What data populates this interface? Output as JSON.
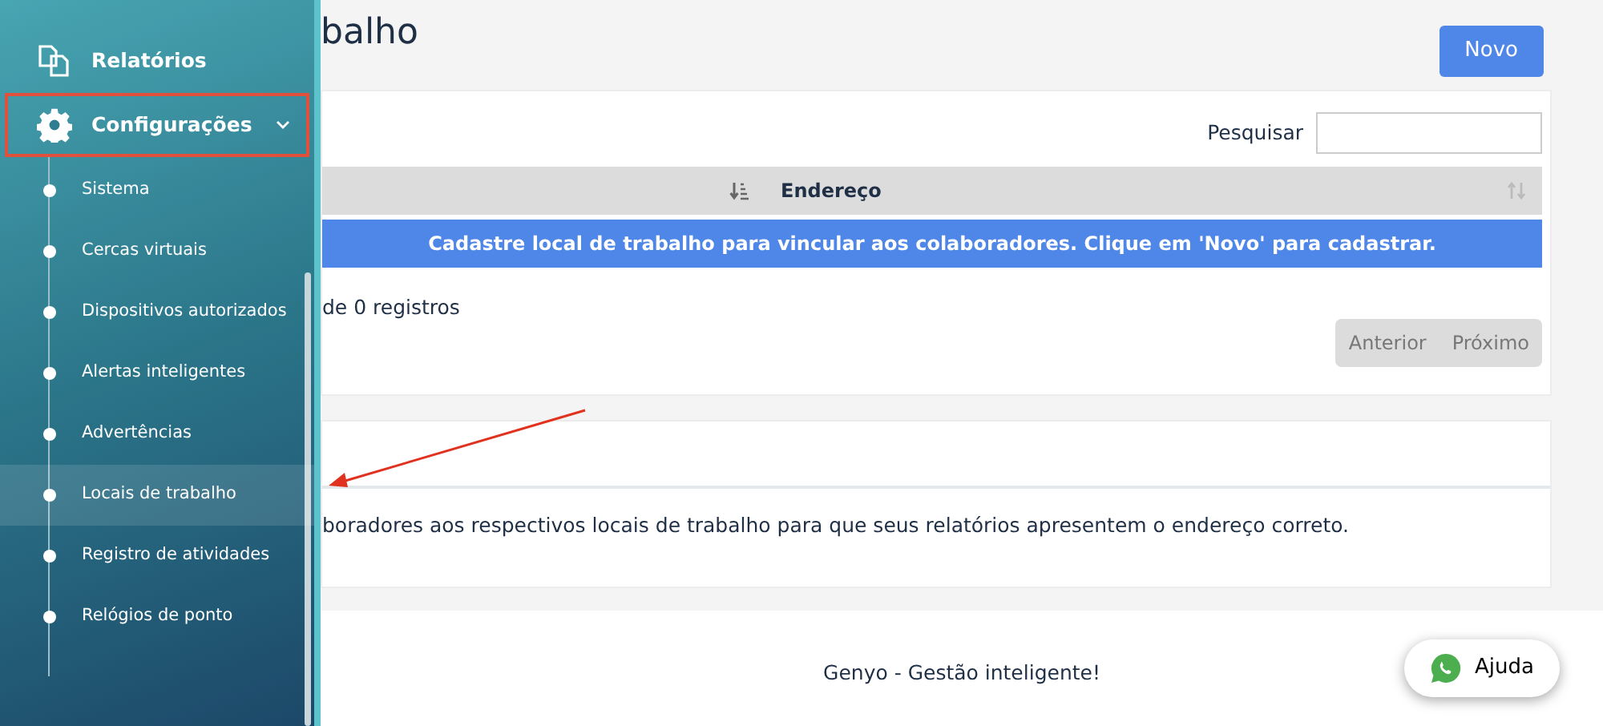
{
  "sidebar": {
    "items": [
      {
        "kind": "reports",
        "label": "Relatórios",
        "outlined": false
      },
      {
        "kind": "settings",
        "label": "Configurações",
        "outlined": true,
        "expanded": true,
        "children": [
          {
            "label": "Sistema",
            "selected": false
          },
          {
            "label": "Cercas virtuais",
            "selected": false
          },
          {
            "label": "Dispositivos autorizados",
            "selected": false
          },
          {
            "label": "Alertas inteligentes",
            "selected": false
          },
          {
            "label": "Advertências",
            "selected": false
          },
          {
            "label": "Locais de trabalho",
            "selected": true
          },
          {
            "label": "Registro de atividades",
            "selected": false
          },
          {
            "label": "Relógios de ponto",
            "selected": false
          }
        ]
      }
    ]
  },
  "page": {
    "title": "balho",
    "new_button": "Novo"
  },
  "table": {
    "search_label": "Pesquisar",
    "columns": [
      {
        "sorted": true
      },
      {
        "label": "Endereço",
        "sorted": false
      }
    ],
    "empty_message": "Cadastre local de trabalho para vincular aos colaboradores. Clique em 'Novo' para cadastrar.",
    "info": "de 0 registros",
    "pagination": [
      {
        "label": "Anterior",
        "disabled": true
      },
      {
        "label": "Próximo",
        "disabled": true
      }
    ]
  },
  "info_card": {
    "text": "boradores aos respectivos locais de trabalho para que seus relatórios apresentem o endereço correto."
  },
  "footer": {
    "text": "Genyo - Gestão inteligente!"
  },
  "help_button": {
    "label": "Ajuda"
  }
}
